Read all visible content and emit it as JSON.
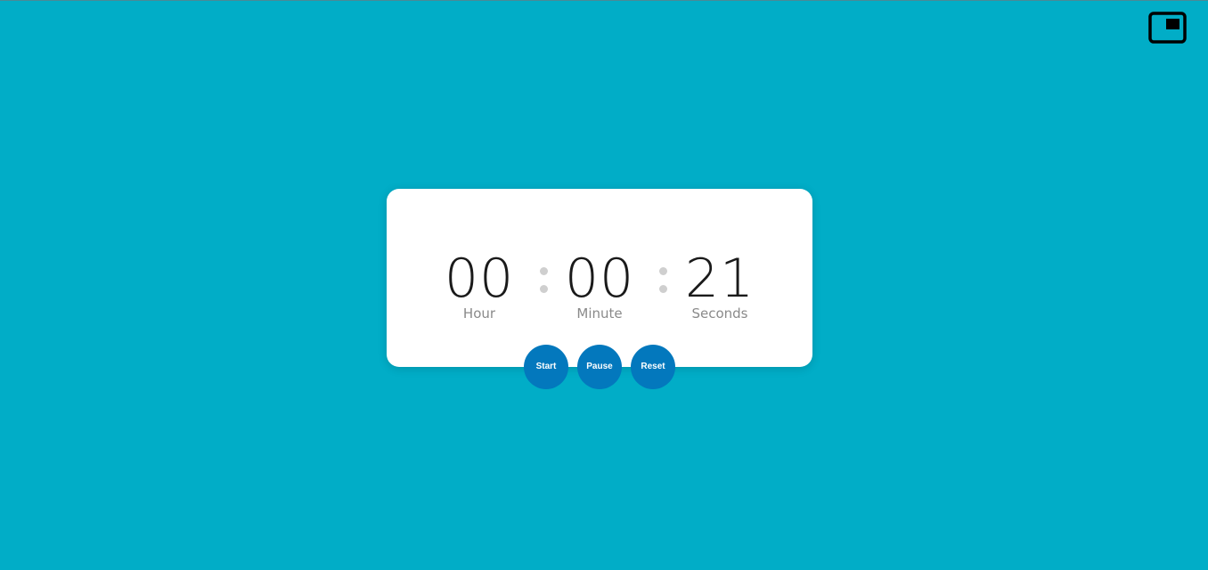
{
  "theme": {
    "background": "#01adc7",
    "card": "#ffffff",
    "button": "#0378bd",
    "separator_dot": "#cfcfcf"
  },
  "pip_button": {
    "icon": "picture-in-picture-icon"
  },
  "timer": {
    "hour": {
      "value": "00",
      "label": "Hour"
    },
    "minute": {
      "value": "00",
      "label": "Minute"
    },
    "seconds": {
      "value": "21",
      "label": "Seconds"
    }
  },
  "controls": {
    "start_label": "Start",
    "pause_label": "Pause",
    "reset_label": "Reset"
  }
}
